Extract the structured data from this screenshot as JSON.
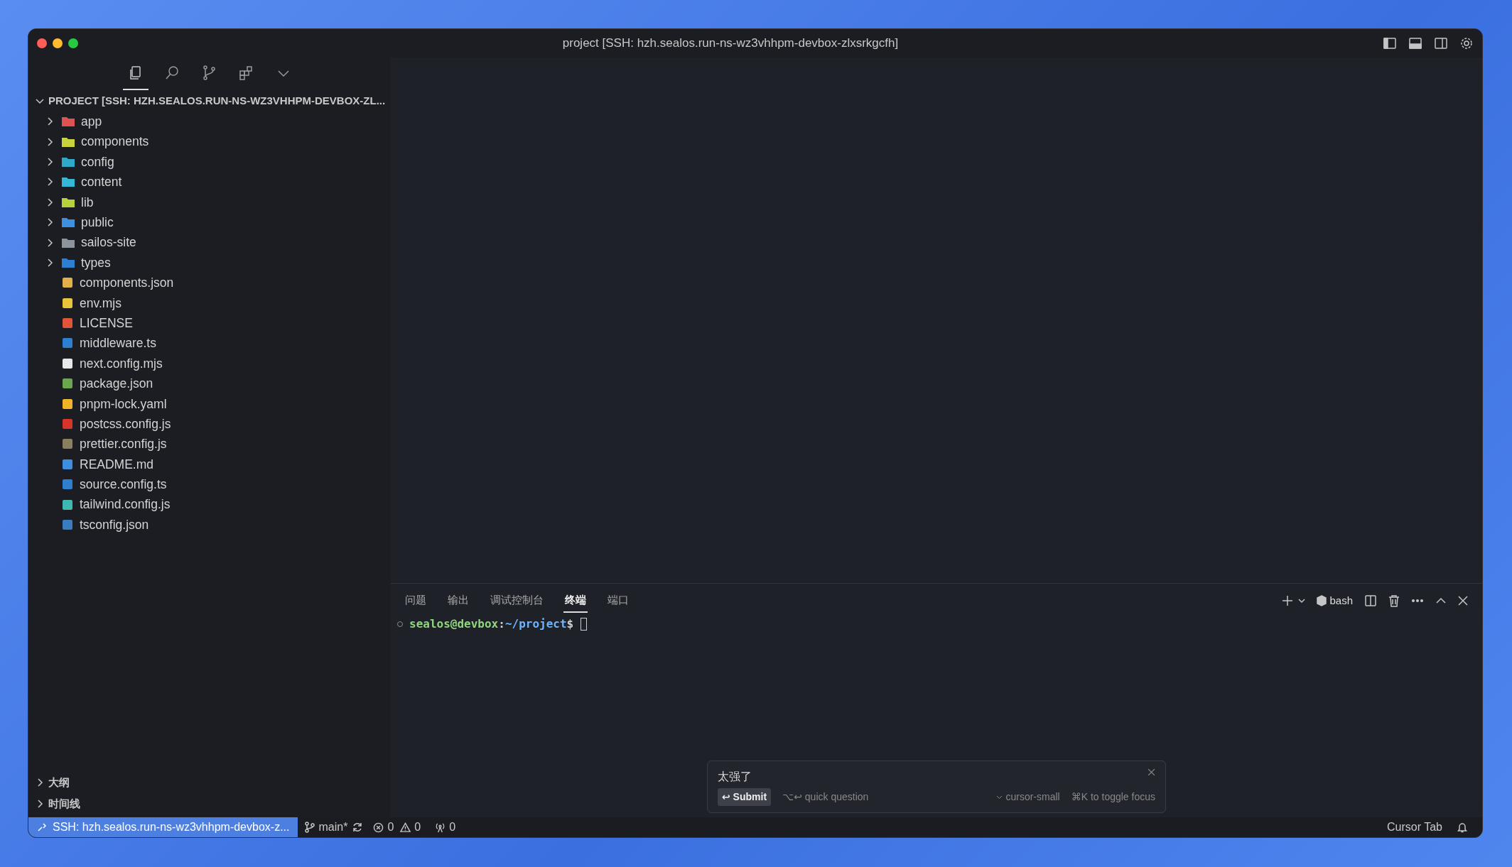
{
  "window": {
    "title": "project [SSH: hzh.sealos.run-ns-wz3vhhpm-devbox-zlxsrkgcfh]"
  },
  "activity_bar": [
    {
      "kind": "explorer",
      "selected": true
    },
    {
      "kind": "search",
      "selected": false
    },
    {
      "kind": "source-control",
      "selected": false
    },
    {
      "kind": "extensions",
      "selected": false
    },
    {
      "kind": "more",
      "selected": false
    }
  ],
  "explorer": {
    "title": "PROJECT [SSH: HZH.SEALOS.RUN-NS-WZ3VHHPM-DEVBOX-ZL...",
    "expanded": true,
    "items": [
      {
        "kind": "folder",
        "name": "app",
        "color": "#e05252",
        "expanded": false
      },
      {
        "kind": "folder",
        "name": "components",
        "color": "#c9d43c",
        "expanded": false
      },
      {
        "kind": "folder",
        "name": "config",
        "color": "#2fa8c9",
        "expanded": false
      },
      {
        "kind": "folder",
        "name": "content",
        "color": "#34b8d6",
        "expanded": false
      },
      {
        "kind": "folder",
        "name": "lib",
        "color": "#b8d03c",
        "expanded": false
      },
      {
        "kind": "folder",
        "name": "public",
        "color": "#3f8fe0",
        "expanded": false
      },
      {
        "kind": "folder",
        "name": "sailos-site",
        "color": "#8e949c",
        "expanded": false
      },
      {
        "kind": "folder",
        "name": "types",
        "color": "#2f7fd0",
        "expanded": false
      },
      {
        "kind": "file",
        "name": "components.json",
        "color": "#e2b04a"
      },
      {
        "kind": "file",
        "name": "env.mjs",
        "color": "#e8c53a"
      },
      {
        "kind": "file",
        "name": "LICENSE",
        "color": "#e0553a"
      },
      {
        "kind": "file",
        "name": "middleware.ts",
        "color": "#2f7fd0"
      },
      {
        "kind": "file",
        "name": "next.config.mjs",
        "color": "#e8e8e8"
      },
      {
        "kind": "file",
        "name": "package.json",
        "color": "#6aa84f"
      },
      {
        "kind": "file",
        "name": "pnpm-lock.yaml",
        "color": "#f0b429"
      },
      {
        "kind": "file",
        "name": "postcss.config.js",
        "color": "#d9342b"
      },
      {
        "kind": "file",
        "name": "prettier.config.js",
        "color": "#8a8060"
      },
      {
        "kind": "file",
        "name": "README.md",
        "color": "#3f8fe0"
      },
      {
        "kind": "file",
        "name": "source.config.ts",
        "color": "#2f7fd0"
      },
      {
        "kind": "file",
        "name": "tailwind.config.js",
        "color": "#3fb8b0"
      },
      {
        "kind": "file",
        "name": "tsconfig.json",
        "color": "#3a7cc0"
      }
    ]
  },
  "bottom_sections": [
    {
      "label": "大纲",
      "expanded": false
    },
    {
      "label": "时间线",
      "expanded": false
    }
  ],
  "panel": {
    "tabs": [
      {
        "label": "问题",
        "selected": false
      },
      {
        "label": "输出",
        "selected": false
      },
      {
        "label": "调试控制台",
        "selected": false
      },
      {
        "label": "终端",
        "selected": true
      },
      {
        "label": "端口",
        "selected": false
      }
    ],
    "shell": "bash",
    "prompt": [
      {
        "text": "sealos@devbox",
        "color": "#8fd77c"
      },
      {
        "text": ":",
        "color": "#d0d0d0"
      },
      {
        "text": "~/project",
        "color": "#6cb6ff"
      },
      {
        "text": "$",
        "color": "#d0d0d0"
      }
    ]
  },
  "prompt_bar": {
    "value": "太强了",
    "submit": "↩ Submit",
    "quick": "⌥↩ quick question",
    "model": "cursor-small",
    "hint": "⌘K to toggle focus"
  },
  "status_bar": {
    "remote": "SSH: hzh.sealos.run-ns-wz3vhhpm-devbox-z...",
    "branch": "main*",
    "errors": "0",
    "warnings": "0",
    "ports": "0",
    "right": "Cursor Tab"
  }
}
